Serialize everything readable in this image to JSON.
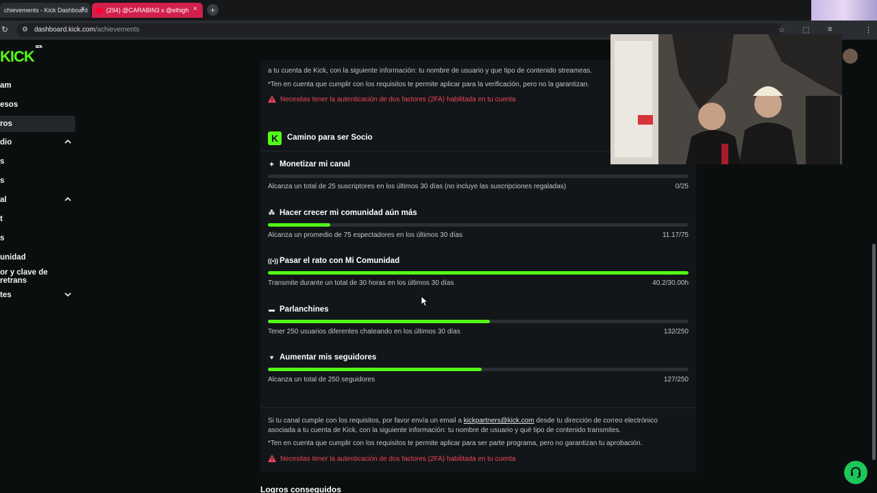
{
  "browser": {
    "tabs": [
      {
        "title": "chievements - Kick Dashboard",
        "close": "×"
      },
      {
        "title": "(294) @CARABIN3 x @elhigh",
        "close": "×"
      }
    ],
    "new_tab": "+",
    "url_domain": "dashboard.kick.com",
    "url_path": "/achievements"
  },
  "sidebar": {
    "logo": "KICK",
    "logo_badge": "BETA",
    "items": [
      {
        "label": "am"
      },
      {
        "label": "esos"
      },
      {
        "label": "ros"
      },
      {
        "label": "dio"
      },
      {
        "label": "s"
      },
      {
        "label": "s"
      },
      {
        "label": "al"
      },
      {
        "label": "t"
      },
      {
        "label": "s"
      },
      {
        "label": "unidad"
      },
      {
        "label": "or y clave de retrans"
      },
      {
        "label": "tes"
      }
    ]
  },
  "prev_card": {
    "line1": "a tu cuenta de Kick, con la siguiente información: tu nombre de usuario y que tipo de contenido streameas.",
    "line2": "*Ten en cuenta que cumplir con los requisitos te permite aplicar para la verificación, pero no la garantizan.",
    "warning": "Necesitas tener la autenticación de dos factores (2FA) habilitada en tu cuenta"
  },
  "partner_card": {
    "badge": "K",
    "title": "Camino para ser Socio",
    "achievements": [
      {
        "icon": "✦",
        "title": "Monetizar mi canal",
        "desc": "Alcanza un total de 25 suscriptores en los últimos 30 días (no incluye las suscripciones regaladas)",
        "value": "0/25",
        "progress": 0.0
      },
      {
        "icon": "⁂",
        "title": "Hacer crecer mi comunidad aún más",
        "desc": "Alcanza un promedio de 75 espectadores en los últimos 30 días",
        "value": "11.17/75",
        "progress": 0.149
      },
      {
        "icon": "((•))",
        "title": "Pasar el rato con Mi Comunidad",
        "desc": "Transmite durante un total de 30 horas en los últimos 30 días",
        "value": "40.2/30.00h",
        "progress": 1.0
      },
      {
        "icon": "▬",
        "title": "Parlanchines",
        "desc": "Tener 250 usuarios diferentes chateando en los últimos 30 días",
        "value": "132/250",
        "progress": 0.528
      },
      {
        "icon": "♥",
        "title": "Aumentar mis seguidores",
        "desc": "Alcanza un total de 250 seguidores",
        "value": "127/250",
        "progress": 0.508
      }
    ],
    "info_pre": "Si tu canal cumple con los requisitos, por favor envía un email a ",
    "info_email": "kickpartners@kick.com",
    "info_post": " desde tu dirección de correo electrónico",
    "info_line2": "asociada a tu cuenta de Kick, con la siguiente información: tu nombre de usuario y qué tipo de contenido transmites.",
    "note": "*Ten en cuenta que cumplir con los requisitos te permite aplicar para ser parte programa, pero no garantizan tu aprobación.",
    "warning": "Necesitas tener la autenticación de dos factores (2FA) habilitada en tu cuenta"
  },
  "achieved_section": {
    "title": "Logros conseguidos"
  },
  "colors": {
    "accent": "#53fc18",
    "warning": "#f0445e",
    "background": "#0b0e0f",
    "card": "#131618"
  }
}
